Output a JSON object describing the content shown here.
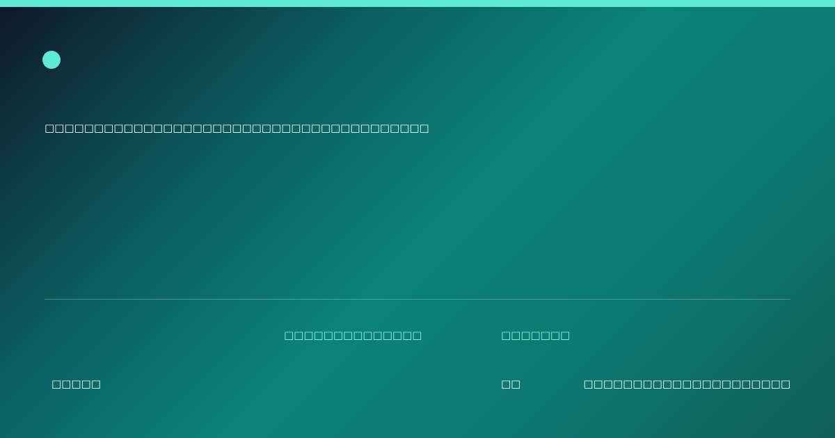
{
  "colors": {
    "accent": "#5eead4",
    "label": "#99f6e4",
    "text": "#ffffff",
    "background_start": "#0f172a",
    "background_mid": "#0c8278",
    "background_end": "#115e59"
  },
  "icons": {
    "brand": "circle-dot-icon"
  },
  "hero": {
    "headline": "□□□□□□□□□□□□□□□□□□□□□□□□□□□□□□□□□□□□□□□"
  },
  "footer": {
    "label_center": "□□□□□□□□□□□□□□",
    "label_right": "□□□□□□□",
    "value_left": "□□□□□",
    "value_center_right": "□□",
    "value_far_right": "□□□□□□□□□□□□□□□□□□□□□"
  }
}
